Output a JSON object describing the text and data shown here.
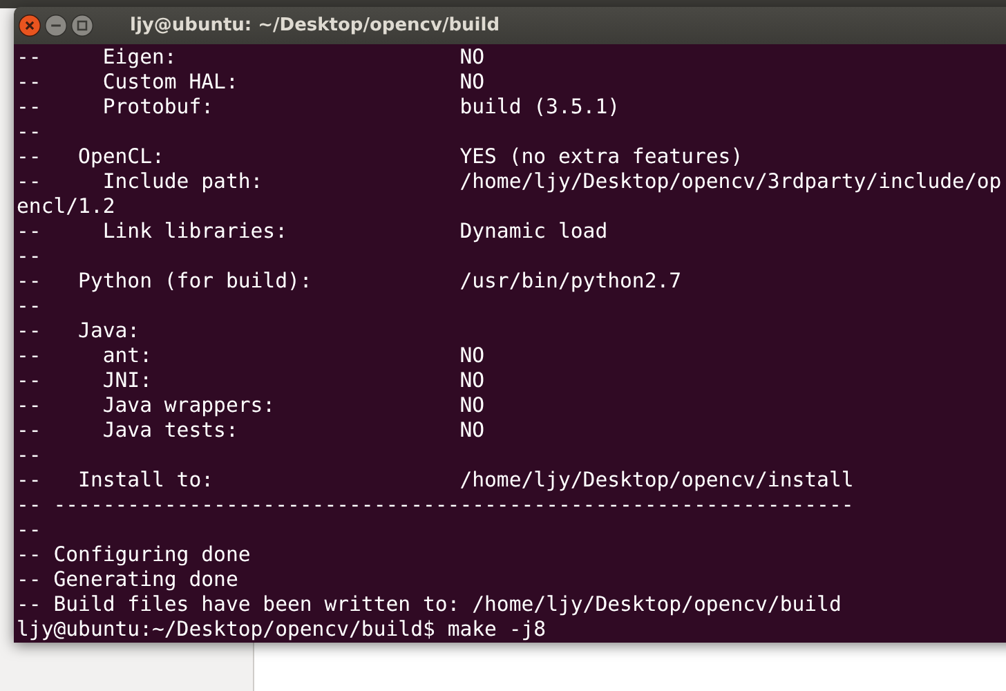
{
  "window": {
    "title": "ljy@ubuntu: ~/Desktop/opencv/build"
  },
  "terminal": {
    "lines": [
      {
        "label": "--     Eigen:",
        "value": "NO"
      },
      {
        "label": "--     Custom HAL:",
        "value": "NO"
      },
      {
        "label": "--     Protobuf:",
        "value": "build (3.5.1)"
      },
      {
        "label": "--"
      },
      {
        "label": "--   OpenCL:",
        "value": "YES (no extra features)"
      },
      {
        "label": "--     Include path:",
        "value": "/home/ljy/Desktop/opencv/3rdparty/include/op"
      },
      {
        "label": "encl/1.2"
      },
      {
        "label": "--     Link libraries:",
        "value": "Dynamic load"
      },
      {
        "label": "--"
      },
      {
        "label": "--   Python (for build):",
        "value": "/usr/bin/python2.7"
      },
      {
        "label": "--"
      },
      {
        "label": "--   Java:"
      },
      {
        "label": "--     ant:",
        "value": "NO"
      },
      {
        "label": "--     JNI:",
        "value": "NO"
      },
      {
        "label": "--     Java wrappers:",
        "value": "NO"
      },
      {
        "label": "--     Java tests:",
        "value": "NO"
      },
      {
        "label": "--"
      },
      {
        "label": "--   Install to:",
        "value": "/home/ljy/Desktop/opencv/install"
      },
      {
        "label": "-- -----------------------------------------------------------------"
      },
      {
        "label": "--"
      },
      {
        "label": "-- Configuring done"
      },
      {
        "label": "-- Generating done"
      },
      {
        "label": "-- Build files have been written to: /home/ljy/Desktop/opencv/build"
      }
    ],
    "prompt": "ljy@ubuntu:~/Desktop/opencv/build$",
    "command": "make -j8"
  }
}
